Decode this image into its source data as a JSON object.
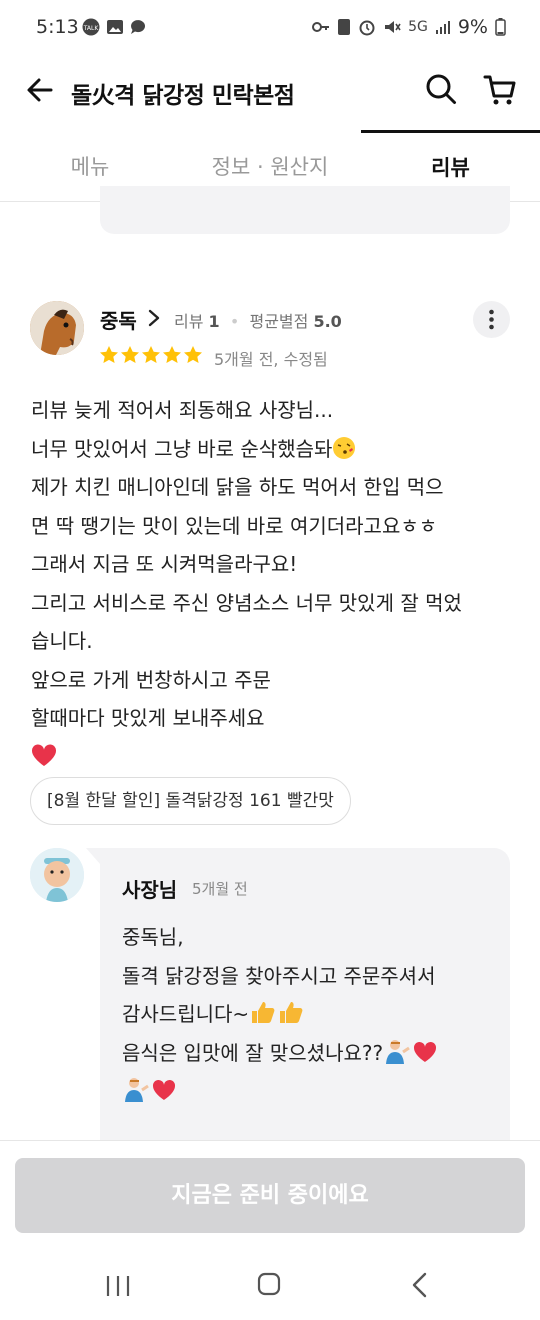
{
  "status_bar": {
    "time": "5:13",
    "battery": "9%",
    "network": "5G"
  },
  "header": {
    "title": "돌火격 닭강정 민락본점",
    "back_icon": "arrow-left-icon",
    "search_icon": "search-icon",
    "cart_icon": "cart-icon"
  },
  "tabs": [
    {
      "label": "메뉴",
      "active": false
    },
    {
      "label": "정보 · 원산지",
      "active": false
    },
    {
      "label": "리뷰",
      "active": true
    }
  ],
  "review": {
    "author": "중독",
    "review_count_label": "리뷰",
    "review_count": "1",
    "avg_label": "평균별점",
    "avg_rating": "5.0",
    "stars": 5,
    "date": "5개월 전, 수정됨",
    "lines": [
      "리뷰 늦게 적어서 죄동해요 사쟝님...",
      "너무 맛있어서 그냥 바로 순삭했슴돠",
      "제가 치킨 매니아인데 닭을 하도 먹어서 한입 먹으",
      "면 딱 땡기는 맛이 있는데 바로 여기더라고요ㅎㅎ",
      "그래서 지금 또 시켜먹을라구요!",
      "그리고 서비스로 주신 양념소스 너무 맛있게 잘 먹었",
      "습니다.",
      "앞으로 가게 번창하시고 주문",
      "할때마다 맛있게 보내주세요"
    ],
    "ordered_menu": "[8월 한달 할인] 돌격닭강정 161 빨간맛"
  },
  "owner_reply": {
    "name": "사장님",
    "date": "5개월 전",
    "lines": [
      "중독님,",
      "돌격 닭강정을 찾아주시고 주문주셔서",
      "감사드립니다~",
      "음식은 입맛에 잘 맞으셨나요??"
    ]
  },
  "cta": {
    "label": "지금은 준비 중이에요"
  },
  "colors": {
    "star": "#ffc107",
    "cta_disabled": "#d4d4d6",
    "heart": "#e8334a"
  }
}
